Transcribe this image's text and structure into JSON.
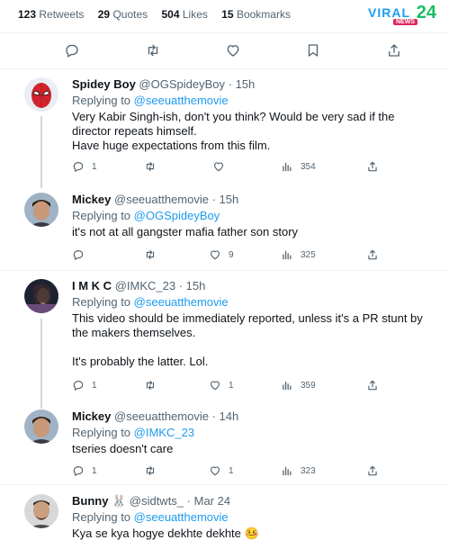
{
  "stats": {
    "retweets_count": "123",
    "retweets_label": "Retweets",
    "quotes_count": "29",
    "quotes_label": "Quotes",
    "likes_count": "504",
    "likes_label": "Likes",
    "bookmarks_count": "15",
    "bookmarks_label": "Bookmarks"
  },
  "logo": {
    "text": "VIRAL",
    "sub": "NEWS",
    "num": "24"
  },
  "colors": {
    "accent": "#1d9bf0",
    "text": "#0f1419",
    "muted": "#536471",
    "border": "#eff3f4",
    "thread": "#cfd9de"
  },
  "icons": [
    "reply-icon",
    "retweet-icon",
    "like-icon",
    "bookmark-icon",
    "share-icon",
    "views-icon"
  ],
  "replies": [
    {
      "name": "Spidey Boy",
      "handle": "@OGSpideyBoy",
      "time": "· 15h",
      "replying_label": "Replying to",
      "replying_to": "@seeuatthemovie",
      "text_lines": [
        "Very Kabir Singh-ish, don't you think? Would be very sad if the director repeats himself.",
        "Have huge expectations from this film."
      ],
      "reply_count": "1",
      "retweet_count": "",
      "like_count": "",
      "view_count": "354"
    },
    {
      "name": "Mickey",
      "handle": "@seeuatthemovie",
      "time": "· 15h",
      "replying_label": "Replying to",
      "replying_to": "@OGSpideyBoy",
      "text_lines": [
        "it's not at all gangster mafia father son story"
      ],
      "reply_count": "",
      "retweet_count": "",
      "like_count": "9",
      "view_count": "325"
    },
    {
      "name": "I M K C",
      "handle": "@IMKC_23",
      "time": "· 15h",
      "replying_label": "Replying to",
      "replying_to": "@seeuatthemovie",
      "text_lines": [
        "This video should be immediately reported, unless it's a PR stunt by the makers themselves.",
        "It's probably the latter. Lol."
      ],
      "reply_count": "1",
      "retweet_count": "",
      "like_count": "1",
      "view_count": "359"
    },
    {
      "name": "Mickey",
      "handle": "@seeuatthemovie",
      "time": "· 14h",
      "replying_label": "Replying to",
      "replying_to": "@IMKC_23",
      "text_lines": [
        "tseries doesn't care"
      ],
      "reply_count": "1",
      "retweet_count": "",
      "like_count": "1",
      "view_count": "323"
    },
    {
      "name": "Bunny 🐰",
      "handle": "@sidtwts_",
      "time": "· Mar 24",
      "replying_label": "Replying to",
      "replying_to": "@seeuatthemovie",
      "text_lines": [
        "Kya se kya hogye dekhte dekhte 🤒"
      ]
    }
  ]
}
